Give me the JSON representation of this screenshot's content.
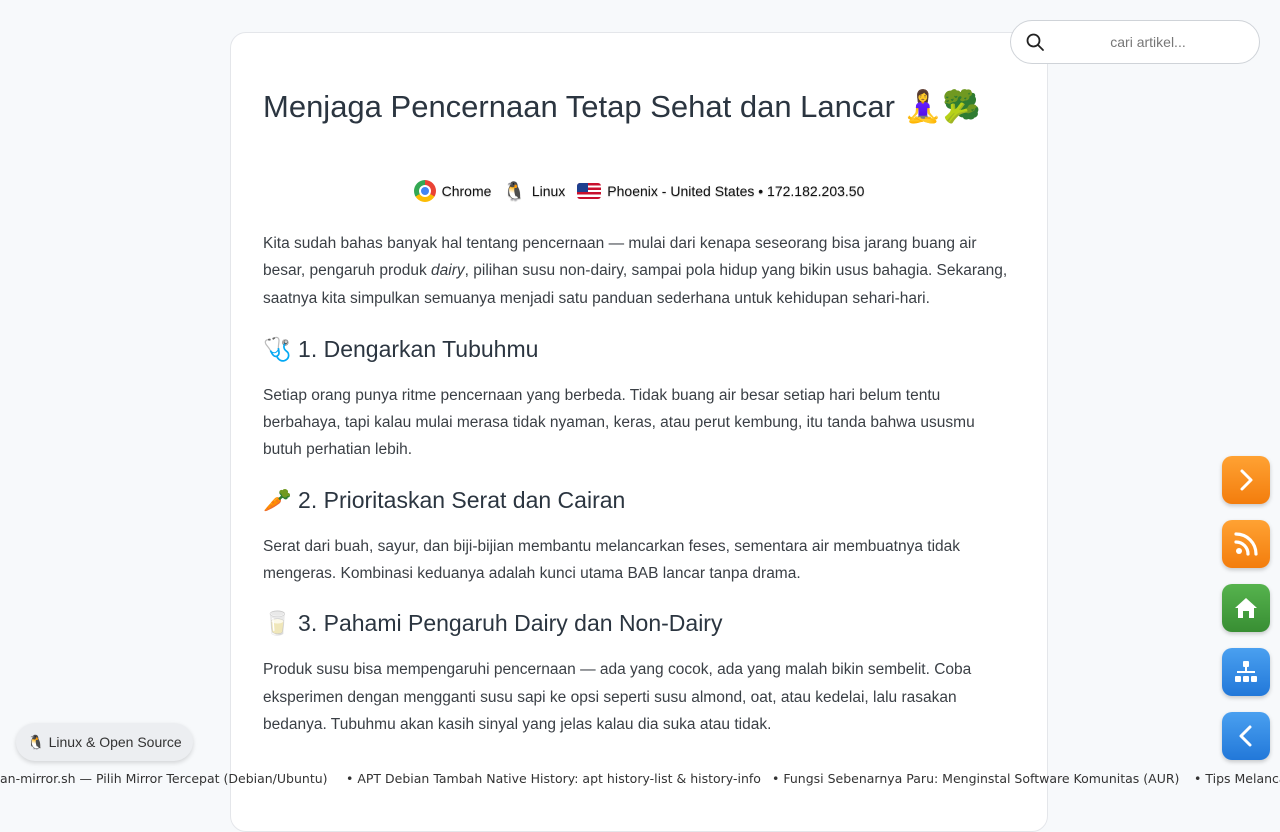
{
  "article": {
    "title": "Menjaga Pencernaan Tetap Sehat dan Lancar 🧘‍♀️🥦",
    "meta": {
      "browser": "Chrome",
      "os": "Linux",
      "location": "Phoenix - United States • 172.182.203.50"
    },
    "intro": {
      "part1": "Kita sudah bahas banyak hal tentang pencernaan — mulai dari kenapa seseorang bisa jarang buang air besar, pengaruh produk ",
      "emphasis": "dairy",
      "part2": ", pilihan susu non-dairy, sampai pola hidup yang bikin usus bahagia. Sekarang, saatnya kita simpulkan semuanya menjadi satu panduan sederhana untuk kehidupan sehari-hari."
    },
    "sections": [
      {
        "heading": "🩺 1. Dengarkan Tubuhmu",
        "body": "Setiap orang punya ritme pencernaan yang berbeda. Tidak buang air besar setiap hari belum tentu berbahaya, tapi kalau mulai merasa tidak nyaman, keras, atau perut kembung, itu tanda bahwa ususmu butuh perhatian lebih."
      },
      {
        "heading": "🥕 2. Prioritaskan Serat dan Cairan",
        "body": "Serat dari buah, sayur, dan biji-bijian membantu melancarkan feses, sementara air membuatnya tidak mengeras. Kombinasi keduanya adalah kunci utama BAB lancar tanpa drama."
      },
      {
        "heading": "🥛 3. Pahami Pengaruh Dairy dan Non-Dairy",
        "body": "Produk susu bisa mempengaruhi pencernaan — ada yang cocok, ada yang malah bikin sembelit. Coba eksperimen dengan mengganti susu sapi ke opsi seperti susu almond, oat, atau kedelai, lalu rasakan bedanya. Tubuhmu akan kasih sinyal yang jelas kalau dia suka atau tidak."
      }
    ]
  },
  "search": {
    "placeholder": "cari artikel..."
  },
  "category_pill": {
    "label": "🐧 Linux & Open Source"
  },
  "ticker": {
    "items": [
      "an-mirror.sh — Pilih Mirror Tercepat (Debian/Ubuntu)",
      "• APT Debian Tambah Native History: apt history-list & history-info",
      "• Fungsi Sebenarnya Paru: Menginstal Software Komunitas (AUR)",
      "• Tips Melancarkan"
    ]
  },
  "fab_icons": [
    "chevron-right-icon",
    "rss-icon",
    "home-icon",
    "sitemap-icon",
    "chevron-left-icon"
  ],
  "colors": {
    "orange_button": "#f68b1f",
    "green_button": "#43a03c",
    "blue_button": "#2f86e4",
    "page_background": "#f7f9fb"
  }
}
